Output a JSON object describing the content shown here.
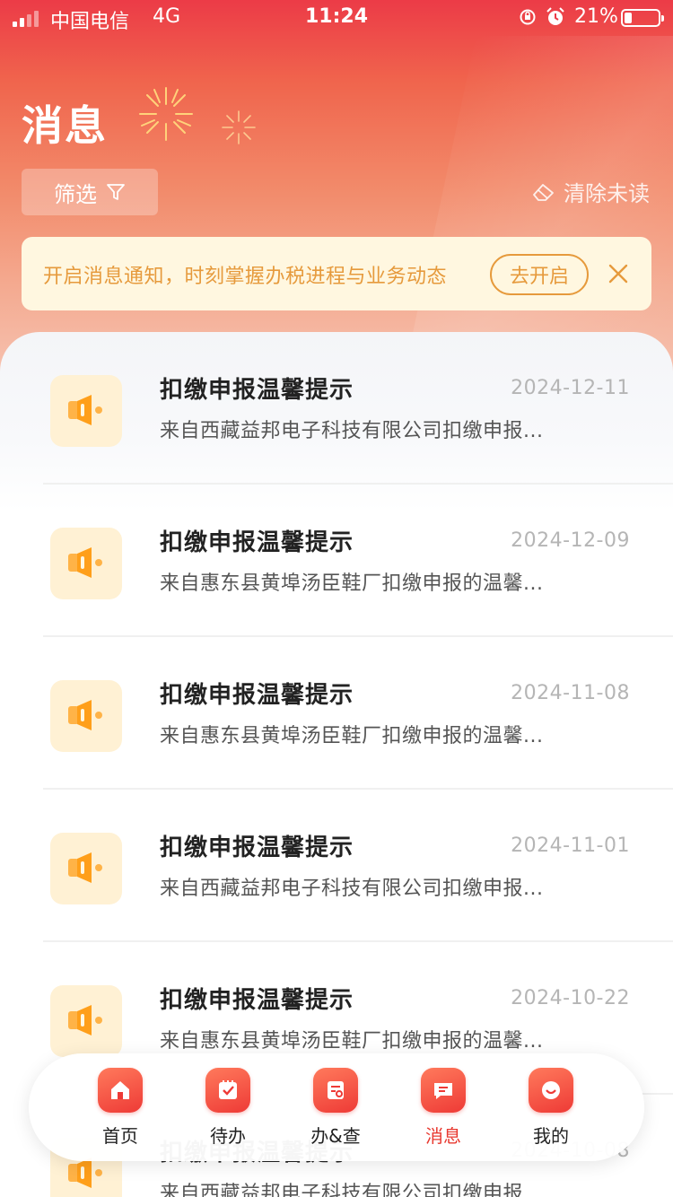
{
  "status_bar": {
    "carrier": "中国电信",
    "network": "4G",
    "time": "11:24",
    "battery_percent": "21%",
    "battery_level": 0.21
  },
  "header": {
    "title": "消息",
    "filter_label": "筛选",
    "filter_icon": "funnel-icon",
    "clear_unread_label": "清除未读",
    "clear_icon": "eraser-icon"
  },
  "notice": {
    "text": "开启消息通知，时刻掌握办税进程与业务动态",
    "button_label": "去开启",
    "close_icon": "close-icon"
  },
  "messages": [
    {
      "title": "扣缴申报温馨提示",
      "date": "2024-12-11",
      "desc": "来自西藏益邦电子科技有限公司扣缴申报..."
    },
    {
      "title": "扣缴申报温馨提示",
      "date": "2024-12-09",
      "desc": "来自惠东县黄埠汤臣鞋厂扣缴申报的温馨..."
    },
    {
      "title": "扣缴申报温馨提示",
      "date": "2024-11-08",
      "desc": "来自惠东县黄埠汤臣鞋厂扣缴申报的温馨..."
    },
    {
      "title": "扣缴申报温馨提示",
      "date": "2024-11-01",
      "desc": "来自西藏益邦电子科技有限公司扣缴申报..."
    },
    {
      "title": "扣缴申报温馨提示",
      "date": "2024-10-22",
      "desc": "来自惠东县黄埠汤臣鞋厂扣缴申报的温馨..."
    },
    {
      "title": "扣缴申报温馨提示",
      "date": "2024-10-08",
      "desc": "来自西藏益邦电子科技有限公司扣缴申报..."
    }
  ],
  "tabbar": {
    "tabs": [
      {
        "label": "首页",
        "icon": "home-icon"
      },
      {
        "label": "待办",
        "icon": "todo-icon"
      },
      {
        "label": "办&查",
        "icon": "handle-query-icon"
      },
      {
        "label": "消息",
        "icon": "message-icon",
        "active": true
      },
      {
        "label": "我的",
        "icon": "smile-icon"
      }
    ]
  },
  "colors": {
    "brand_red": "#e8382f",
    "notice_orange": "#e69a3c",
    "notice_bg": "#fff7e0"
  }
}
